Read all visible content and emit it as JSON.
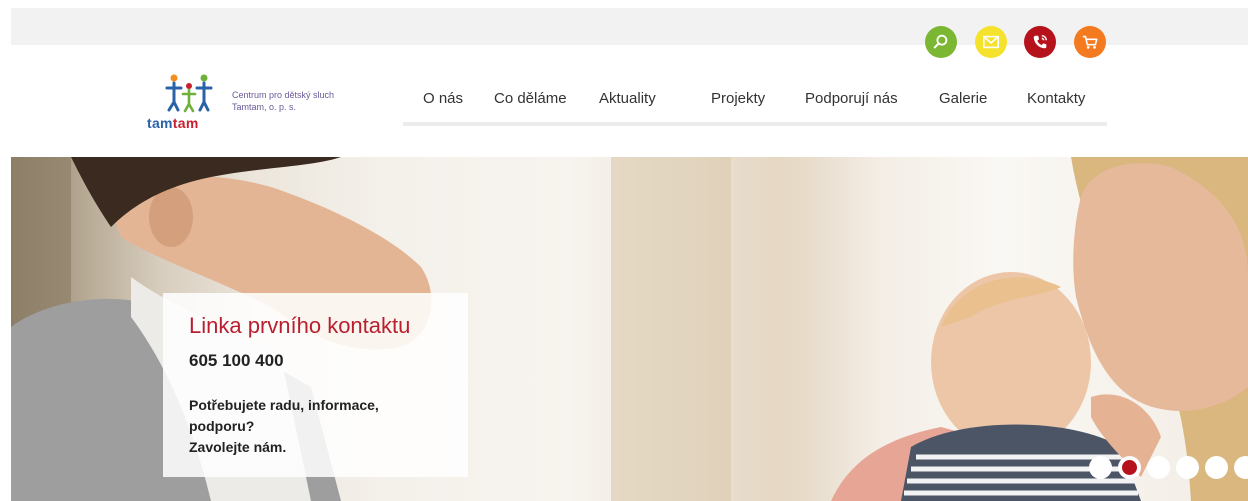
{
  "header": {
    "icons": [
      {
        "name": "search-icon",
        "color": "#7cb733"
      },
      {
        "name": "mail-icon",
        "color": "#f5e22c"
      },
      {
        "name": "phone-icon",
        "color": "#b5121b"
      },
      {
        "name": "cart-icon",
        "color": "#f47a20"
      }
    ]
  },
  "logo": {
    "wordmark_part1": "tam",
    "wordmark_part2": "tam",
    "tagline_line1": "Centrum pro dětský sluch",
    "tagline_line2": "Tamtam, o. p. s.",
    "colors": {
      "blue": "#2a62a8",
      "red": "#c8202f",
      "green": "#6fb03a",
      "orange": "#f18e1c"
    }
  },
  "nav": {
    "items": [
      "O nás",
      "Co děláme",
      "Aktuality",
      "Projekty",
      "Podporují nás",
      "Galerie",
      "Kontakty"
    ]
  },
  "hero": {
    "title": "Linka prvního kontaktu",
    "phone": "605 100 400",
    "text_line1": "Potřebujete radu, informace,",
    "text_line2": "podporu?",
    "text_line3": "Zavolejte nám.",
    "slider": {
      "count": 6,
      "active": 2
    }
  }
}
